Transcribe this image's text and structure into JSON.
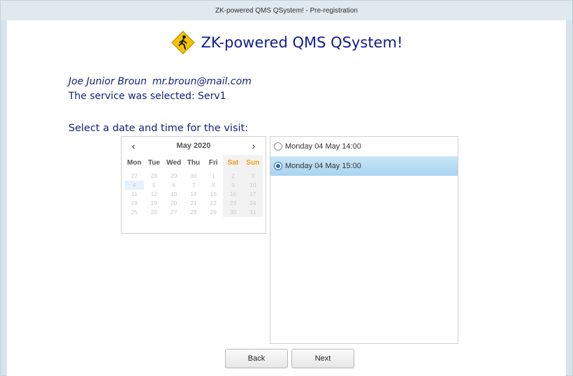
{
  "window": {
    "title": "ZK-powered QMS QSystem! - Pre-registration"
  },
  "header": {
    "title": "ZK-powered QMS QSystem!"
  },
  "user": {
    "name": "Joe Junior Broun",
    "email": "mr.broun@mail.com"
  },
  "service_line": "The service was selected: Serv1",
  "prompt": "Select a date and time for the visit:",
  "calendar": {
    "month_label": "May 2020",
    "prev": "‹",
    "next": "›",
    "weekdays": [
      "Mon",
      "Tue",
      "Wed",
      "Thu",
      "Fri",
      "Sat",
      "Sun"
    ],
    "weeks": [
      [
        "27",
        "28",
        "29",
        "30",
        "1",
        "2",
        "3"
      ],
      [
        "4",
        "5",
        "6",
        "7",
        "8",
        "9",
        "10"
      ],
      [
        "11",
        "12",
        "13",
        "14",
        "15",
        "16",
        "17"
      ],
      [
        "18",
        "19",
        "20",
        "21",
        "22",
        "23",
        "24"
      ],
      [
        "25",
        "26",
        "27",
        "28",
        "29",
        "30",
        "31"
      ]
    ],
    "selected_day": "4"
  },
  "slots": [
    {
      "label": "Monday 04 May 14:00",
      "selected": false
    },
    {
      "label": "Monday 04 May 15:00",
      "selected": true
    }
  ],
  "buttons": {
    "back": "Back",
    "next": "Next"
  },
  "colors": {
    "accent": "#15207e",
    "weekend": "#f39c12",
    "selection": "#a8d4f0"
  }
}
